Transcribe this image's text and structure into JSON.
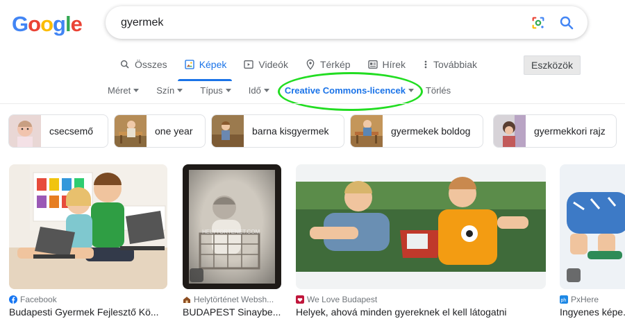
{
  "logo": {
    "letters": [
      "G",
      "o",
      "o",
      "g",
      "l",
      "e"
    ],
    "colors": [
      "#4285f4",
      "#ea4335",
      "#fbbc05",
      "#4285f4",
      "#34a853",
      "#ea4335"
    ]
  },
  "search": {
    "query": "gyermek"
  },
  "tabs": [
    {
      "label": "Összes",
      "icon": "search-icon"
    },
    {
      "label": "Képek",
      "icon": "image-icon",
      "active": true
    },
    {
      "label": "Videók",
      "icon": "play-icon"
    },
    {
      "label": "Térkép",
      "icon": "map-pin-icon"
    },
    {
      "label": "Hírek",
      "icon": "news-icon"
    },
    {
      "label": "Továbbiak",
      "icon": "more-vert-icon"
    }
  ],
  "tools_label": "Eszközök",
  "filters": [
    {
      "label": "Méret"
    },
    {
      "label": "Szín"
    },
    {
      "label": "Típus"
    },
    {
      "label": "Idő"
    },
    {
      "label": "Creative Commons-licencek",
      "active": true
    }
  ],
  "clear_label": "Törlés",
  "related": [
    {
      "label": "csecsemő"
    },
    {
      "label": "one year"
    },
    {
      "label": "barna kisgyermek"
    },
    {
      "label": "gyermekek boldog"
    },
    {
      "label": "gyermekkori rajz"
    }
  ],
  "results": [
    {
      "source": "Facebook",
      "title": "Budapesti Gyermek Fejlesztő Kö..."
    },
    {
      "source": "Helytörténet Websh...",
      "title": "BUDAPEST Sinaybe..."
    },
    {
      "source": "We Love Budapest",
      "title": "Helyek, ahová minden gyereknek el kell látogatni"
    },
    {
      "source": "PxHere",
      "title": "Ingyenes képe..."
    }
  ],
  "colors": {
    "accent": "#1a73e8",
    "highlight_oval": "#22dd22"
  }
}
